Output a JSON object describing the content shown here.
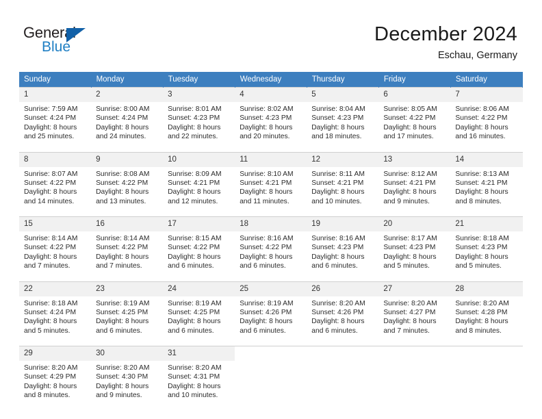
{
  "brand": {
    "name_dark": "General",
    "name_blue": "Blue",
    "triangle_color": "#1261a8",
    "blue_color": "#1f7fc4"
  },
  "header": {
    "title": "December 2024",
    "subtitle": "Eschau, Germany",
    "accent_color": "#3d7fbf",
    "daynum_bg": "#f1f1f1"
  },
  "weekdays": [
    "Sunday",
    "Monday",
    "Tuesday",
    "Wednesday",
    "Thursday",
    "Friday",
    "Saturday"
  ],
  "labels": {
    "sunrise_prefix": "Sunrise:",
    "sunset_prefix": "Sunset:",
    "daylight_prefix": "Daylight:"
  },
  "days": [
    {
      "n": "1",
      "l1": "Sunrise: 7:59 AM",
      "l2": "Sunset: 4:24 PM",
      "l3": "Daylight: 8 hours",
      "l4": "and 25 minutes."
    },
    {
      "n": "2",
      "l1": "Sunrise: 8:00 AM",
      "l2": "Sunset: 4:24 PM",
      "l3": "Daylight: 8 hours",
      "l4": "and 24 minutes."
    },
    {
      "n": "3",
      "l1": "Sunrise: 8:01 AM",
      "l2": "Sunset: 4:23 PM",
      "l3": "Daylight: 8 hours",
      "l4": "and 22 minutes."
    },
    {
      "n": "4",
      "l1": "Sunrise: 8:02 AM",
      "l2": "Sunset: 4:23 PM",
      "l3": "Daylight: 8 hours",
      "l4": "and 20 minutes."
    },
    {
      "n": "5",
      "l1": "Sunrise: 8:04 AM",
      "l2": "Sunset: 4:23 PM",
      "l3": "Daylight: 8 hours",
      "l4": "and 18 minutes."
    },
    {
      "n": "6",
      "l1": "Sunrise: 8:05 AM",
      "l2": "Sunset: 4:22 PM",
      "l3": "Daylight: 8 hours",
      "l4": "and 17 minutes."
    },
    {
      "n": "7",
      "l1": "Sunrise: 8:06 AM",
      "l2": "Sunset: 4:22 PM",
      "l3": "Daylight: 8 hours",
      "l4": "and 16 minutes."
    },
    {
      "n": "8",
      "l1": "Sunrise: 8:07 AM",
      "l2": "Sunset: 4:22 PM",
      "l3": "Daylight: 8 hours",
      "l4": "and 14 minutes."
    },
    {
      "n": "9",
      "l1": "Sunrise: 8:08 AM",
      "l2": "Sunset: 4:22 PM",
      "l3": "Daylight: 8 hours",
      "l4": "and 13 minutes."
    },
    {
      "n": "10",
      "l1": "Sunrise: 8:09 AM",
      "l2": "Sunset: 4:21 PM",
      "l3": "Daylight: 8 hours",
      "l4": "and 12 minutes."
    },
    {
      "n": "11",
      "l1": "Sunrise: 8:10 AM",
      "l2": "Sunset: 4:21 PM",
      "l3": "Daylight: 8 hours",
      "l4": "and 11 minutes."
    },
    {
      "n": "12",
      "l1": "Sunrise: 8:11 AM",
      "l2": "Sunset: 4:21 PM",
      "l3": "Daylight: 8 hours",
      "l4": "and 10 minutes."
    },
    {
      "n": "13",
      "l1": "Sunrise: 8:12 AM",
      "l2": "Sunset: 4:21 PM",
      "l3": "Daylight: 8 hours",
      "l4": "and 9 minutes."
    },
    {
      "n": "14",
      "l1": "Sunrise: 8:13 AM",
      "l2": "Sunset: 4:21 PM",
      "l3": "Daylight: 8 hours",
      "l4": "and 8 minutes."
    },
    {
      "n": "15",
      "l1": "Sunrise: 8:14 AM",
      "l2": "Sunset: 4:22 PM",
      "l3": "Daylight: 8 hours",
      "l4": "and 7 minutes."
    },
    {
      "n": "16",
      "l1": "Sunrise: 8:14 AM",
      "l2": "Sunset: 4:22 PM",
      "l3": "Daylight: 8 hours",
      "l4": "and 7 minutes."
    },
    {
      "n": "17",
      "l1": "Sunrise: 8:15 AM",
      "l2": "Sunset: 4:22 PM",
      "l3": "Daylight: 8 hours",
      "l4": "and 6 minutes."
    },
    {
      "n": "18",
      "l1": "Sunrise: 8:16 AM",
      "l2": "Sunset: 4:22 PM",
      "l3": "Daylight: 8 hours",
      "l4": "and 6 minutes."
    },
    {
      "n": "19",
      "l1": "Sunrise: 8:16 AM",
      "l2": "Sunset: 4:23 PM",
      "l3": "Daylight: 8 hours",
      "l4": "and 6 minutes."
    },
    {
      "n": "20",
      "l1": "Sunrise: 8:17 AM",
      "l2": "Sunset: 4:23 PM",
      "l3": "Daylight: 8 hours",
      "l4": "and 5 minutes."
    },
    {
      "n": "21",
      "l1": "Sunrise: 8:18 AM",
      "l2": "Sunset: 4:23 PM",
      "l3": "Daylight: 8 hours",
      "l4": "and 5 minutes."
    },
    {
      "n": "22",
      "l1": "Sunrise: 8:18 AM",
      "l2": "Sunset: 4:24 PM",
      "l3": "Daylight: 8 hours",
      "l4": "and 5 minutes."
    },
    {
      "n": "23",
      "l1": "Sunrise: 8:19 AM",
      "l2": "Sunset: 4:25 PM",
      "l3": "Daylight: 8 hours",
      "l4": "and 6 minutes."
    },
    {
      "n": "24",
      "l1": "Sunrise: 8:19 AM",
      "l2": "Sunset: 4:25 PM",
      "l3": "Daylight: 8 hours",
      "l4": "and 6 minutes."
    },
    {
      "n": "25",
      "l1": "Sunrise: 8:19 AM",
      "l2": "Sunset: 4:26 PM",
      "l3": "Daylight: 8 hours",
      "l4": "and 6 minutes."
    },
    {
      "n": "26",
      "l1": "Sunrise: 8:20 AM",
      "l2": "Sunset: 4:26 PM",
      "l3": "Daylight: 8 hours",
      "l4": "and 6 minutes."
    },
    {
      "n": "27",
      "l1": "Sunrise: 8:20 AM",
      "l2": "Sunset: 4:27 PM",
      "l3": "Daylight: 8 hours",
      "l4": "and 7 minutes."
    },
    {
      "n": "28",
      "l1": "Sunrise: 8:20 AM",
      "l2": "Sunset: 4:28 PM",
      "l3": "Daylight: 8 hours",
      "l4": "and 8 minutes."
    },
    {
      "n": "29",
      "l1": "Sunrise: 8:20 AM",
      "l2": "Sunset: 4:29 PM",
      "l3": "Daylight: 8 hours",
      "l4": "and 8 minutes."
    },
    {
      "n": "30",
      "l1": "Sunrise: 8:20 AM",
      "l2": "Sunset: 4:30 PM",
      "l3": "Daylight: 8 hours",
      "l4": "and 9 minutes."
    },
    {
      "n": "31",
      "l1": "Sunrise: 8:20 AM",
      "l2": "Sunset: 4:31 PM",
      "l3": "Daylight: 8 hours",
      "l4": "and 10 minutes."
    }
  ]
}
